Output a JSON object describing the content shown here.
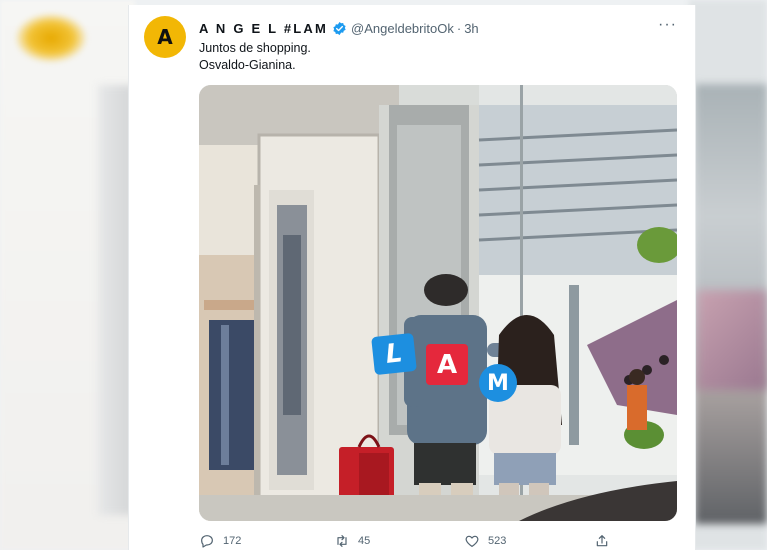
{
  "tweet": {
    "avatar_letter": "A",
    "display_name": "A N G E L #LAM",
    "handle": "@AngeldebritoOk",
    "separator": "·",
    "time": "3h",
    "more_label": "···",
    "text_lines": [
      "Juntos de shopping.",
      "Osvaldo-Gianina."
    ],
    "accent_color": "#f2b705",
    "verified_color": "#1d9bf0"
  },
  "media": {
    "watermark_letters": [
      "L",
      "A",
      "M"
    ],
    "watermark_colors": [
      "#1d8fe0",
      "#e5283c",
      "#1d8fe0"
    ]
  },
  "actions": {
    "reply_count": "172",
    "retweet_count": "45",
    "like_count": "523",
    "icons": [
      "reply-icon",
      "retweet-icon",
      "like-icon",
      "share-icon"
    ]
  }
}
